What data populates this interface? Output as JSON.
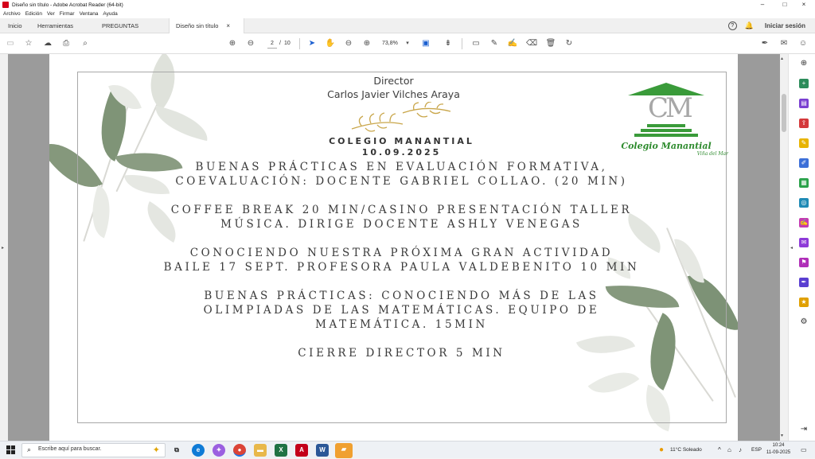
{
  "window": {
    "title": "Diseño sin título - Adobe Acrobat Reader (64-bit)",
    "controls": [
      "–",
      "□",
      "×"
    ]
  },
  "menu": [
    "Archivo",
    "Edición",
    "Ver",
    "Firmar",
    "Ventana",
    "Ayuda"
  ],
  "tabs": {
    "home": "Inicio",
    "tools": "Herramientas",
    "doc1": "PREGUNTAS FRECU...",
    "doc2": "Diseño sin título",
    "close": "×",
    "help": "?",
    "signin": "Iniciar sesión"
  },
  "toolbar": {
    "page_current": "2",
    "page_separator": "/",
    "page_total": "10",
    "zoom": "73,8%"
  },
  "document": {
    "director_title": "Director",
    "director_name": "Carlos Javier Vilches Araya",
    "school": "COLEGIO MANANTIAL",
    "date": "10.09.2025",
    "agenda": [
      [
        "BUENAS PRÁCTICAS EN EVALUACIÓN FORMATIVA,",
        "COEVALUACIÓN: DOCENTE  GABRIEL COLLAO. (20 MIN)"
      ],
      [
        "COFFEE BREAK 20 MIN/CASINO PRESENTACIÓN TALLER",
        "MÚSICA. DIRIGE DOCENTE ASHLY VENEGAS"
      ],
      [
        "CONOCIENDO NUESTRA PRÓXIMA GRAN ACTIVIDAD",
        "BAILE 17 SEPT. PROFESORA PAULA VALDEBENITO  10 MIN"
      ],
      [
        "BUENAS PRÁCTICAS: CONOCIENDO MÁS DE LAS",
        "OLIMPIADAS DE LAS MATEMÁTICAS. EQUIPO DE",
        "MATEMÁTICA. 15MIN"
      ],
      [
        "CIERRE DIRECTOR 5 MIN"
      ]
    ],
    "logo_letters": "CM",
    "logo_name": "Colegio Manantial",
    "logo_sub": "Viña del Mar"
  },
  "taskbar": {
    "search_placeholder": "Escribe aquí para buscar.",
    "weather": "11°C  Soleado",
    "lang": "ESP",
    "time": "10:24",
    "date": "11-09-2025"
  },
  "colors": {
    "leaf_dark": "#7f9477",
    "leaf_light": "#d8dcd3",
    "logo_green": "#3a9b3a",
    "acrobat_red": "#d4001a"
  }
}
